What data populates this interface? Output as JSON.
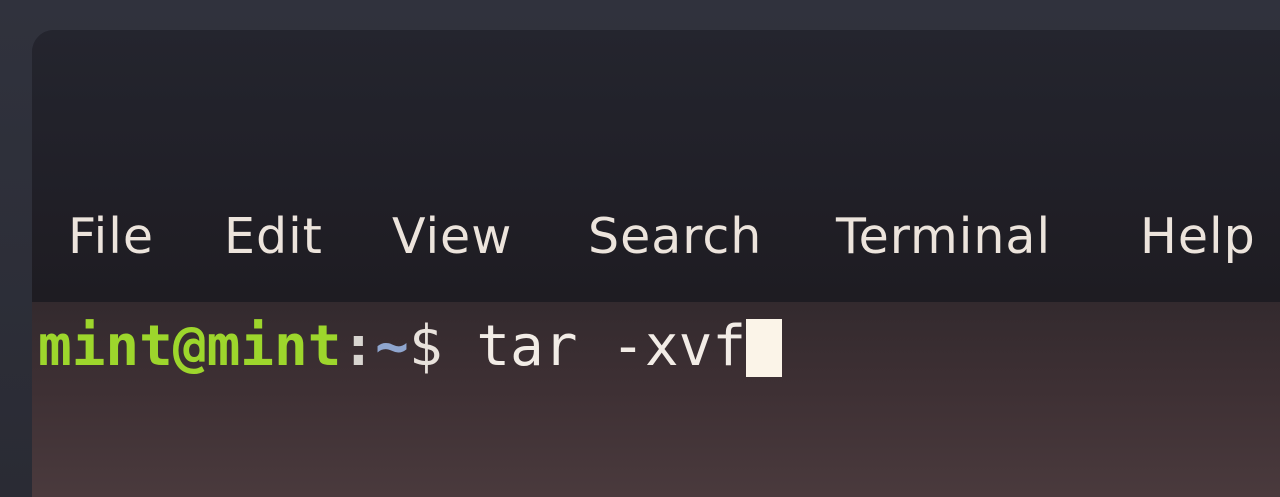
{
  "menubar": {
    "items": [
      {
        "label": "File"
      },
      {
        "label": "Edit"
      },
      {
        "label": "View"
      },
      {
        "label": "Search"
      },
      {
        "label": "Terminal"
      },
      {
        "label": "Help"
      }
    ]
  },
  "terminal": {
    "prompt": {
      "user_host": "mint@mint",
      "separator": ":",
      "path": "~",
      "symbol": "$"
    },
    "command": "tar -xvf"
  },
  "colors": {
    "prompt_user": "#9dd62c",
    "prompt_path": "#8fa6cf",
    "text": "#f2ece6",
    "cursor": "#fbf4e8",
    "menu_text": "#ece4dc"
  }
}
